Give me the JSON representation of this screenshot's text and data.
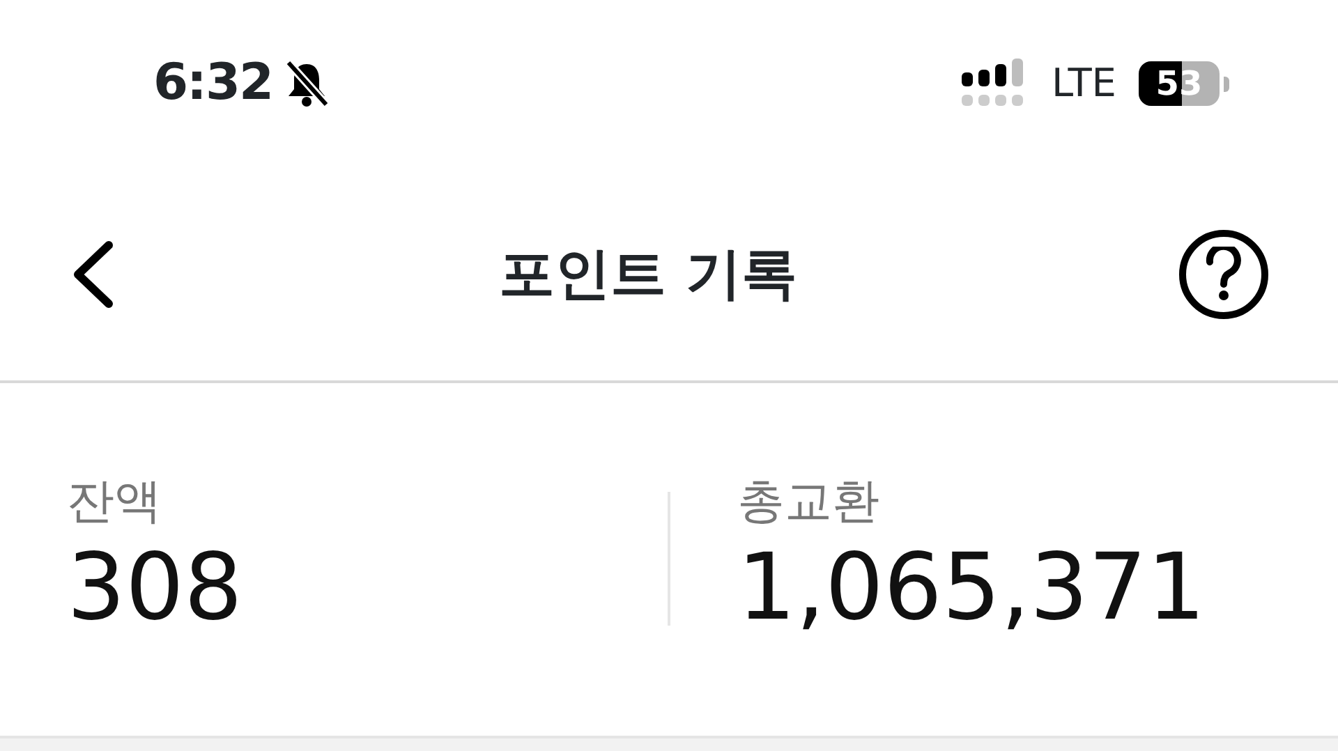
{
  "status_bar": {
    "time": "6:32",
    "silent": true,
    "network": "LTE",
    "battery": "53"
  },
  "header": {
    "title": "포인트 기록"
  },
  "stats": [
    {
      "label": "잔액",
      "value": "308"
    },
    {
      "label": "총교환",
      "value": "1,065,371"
    }
  ]
}
